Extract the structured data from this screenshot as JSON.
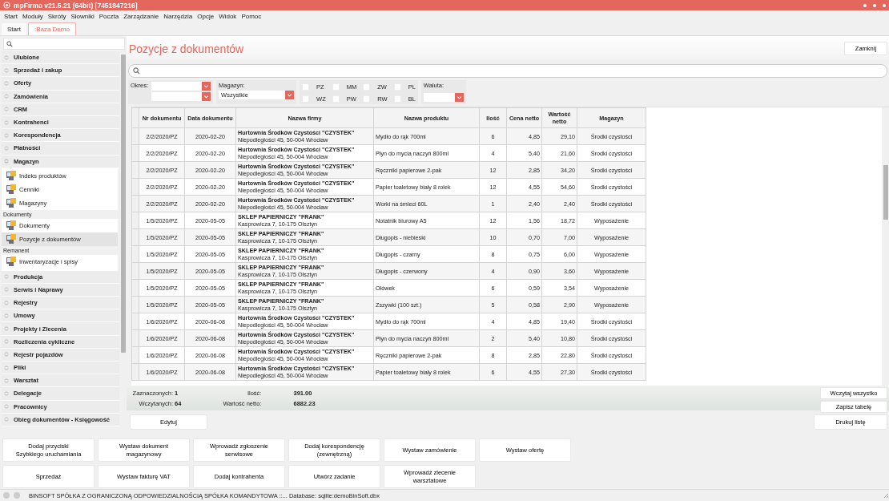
{
  "window": {
    "title": "mpFirma v21.5.21 (64bit) [7451847216]"
  },
  "menu": [
    "Start",
    "Moduły",
    "Skróty",
    "Słowniki",
    "Poczta",
    "Zarządzanie",
    "Narzędzia",
    "Opcje",
    "Widok",
    "Pomoc"
  ],
  "tabs": [
    {
      "label": "Start",
      "selected": false
    },
    {
      "label": ":Baza Demo",
      "selected": true
    }
  ],
  "sidebar": {
    "groups": [
      {
        "label": "Ulubione",
        "expanded": false
      },
      {
        "label": "Sprzedaż i zakup",
        "expanded": false
      },
      {
        "label": "Oferty",
        "expanded": false
      },
      {
        "label": "Zamówienia",
        "expanded": false
      },
      {
        "label": "CRM",
        "expanded": false
      },
      {
        "label": "Kontrahenci",
        "expanded": false
      },
      {
        "label": "Korespondencja",
        "expanded": false
      },
      {
        "label": "Płatności",
        "expanded": false
      },
      {
        "label": "Magazyn",
        "expanded": true,
        "children": [
          {
            "kind": "item",
            "label": "Indeks produktów",
            "selected": false
          },
          {
            "kind": "item",
            "label": "Cenniki",
            "selected": false
          },
          {
            "kind": "item",
            "label": "Magazyny",
            "selected": false
          },
          {
            "kind": "section",
            "label": "Dokumenty"
          },
          {
            "kind": "item",
            "label": "Dokumenty",
            "selected": false
          },
          {
            "kind": "item",
            "label": "Pozycje z dokumentów",
            "selected": true
          },
          {
            "kind": "section",
            "label": "Remanent"
          },
          {
            "kind": "item",
            "label": "Inwentaryzacje i spisy",
            "selected": false
          }
        ]
      },
      {
        "label": "Produkcja",
        "expanded": false
      },
      {
        "label": "Serwis i Naprawy",
        "expanded": false
      },
      {
        "label": "Rejestry",
        "expanded": false
      },
      {
        "label": "Umowy",
        "expanded": false
      },
      {
        "label": "Projekty i Zlecenia",
        "expanded": false
      },
      {
        "label": "Rozliczenia cykliczne",
        "expanded": false
      },
      {
        "label": "Rejestr pojazdów",
        "expanded": false
      },
      {
        "label": "Pliki",
        "expanded": false
      },
      {
        "label": "Warsztat",
        "expanded": false
      },
      {
        "label": "Delegacje",
        "expanded": false
      },
      {
        "label": "Pracownicy",
        "expanded": false
      },
      {
        "label": "Obieg dokumentów - Księgowość",
        "expanded": false
      }
    ]
  },
  "page": {
    "title": "Pozycje z dokumentów",
    "close_button": "Zamknij"
  },
  "filters": {
    "period_label": "Okres:",
    "warehouse_label": "Magazyn:",
    "warehouse_value": "Wszystkie",
    "currency_label": "Waluta:",
    "doc_types": [
      {
        "label": "PZ",
        "checked": false
      },
      {
        "label": "WZ",
        "checked": false
      },
      {
        "label": "MM",
        "checked": false
      },
      {
        "label": "PW",
        "checked": false
      },
      {
        "label": "ZW",
        "checked": false
      },
      {
        "label": "RW",
        "checked": false
      },
      {
        "label": "PL",
        "checked": false
      },
      {
        "label": "BL",
        "checked": false
      }
    ]
  },
  "table": {
    "columns": [
      "Nr dokumentu",
      "Data dokumentu",
      "Nazwa firmy",
      "Nazwa produktu",
      "Ilość",
      "Cena netto",
      "Wartość netto",
      "Magazyn"
    ],
    "rows": [
      {
        "nr": "2/2/2020/PZ",
        "date": "2020-02-20",
        "company": "Hurtownia Środków Czystości \"CZYSTEK\"",
        "address": "Niepodległości 45, 50-004 Wrocław",
        "product": "Mydło do rąk 700ml",
        "qty": "6",
        "price": "4,85",
        "value": "29,10",
        "warehouse": "Środki czystości"
      },
      {
        "nr": "2/2/2020/PZ",
        "date": "2020-02-20",
        "company": "Hurtownia Środków Czystości \"CZYSTEK\"",
        "address": "Niepodległości 45, 50-004 Wrocław",
        "product": "Płyn do mycia naczyń 800ml",
        "qty": "4",
        "price": "5,40",
        "value": "21,60",
        "warehouse": "Środki czystości"
      },
      {
        "nr": "2/2/2020/PZ",
        "date": "2020-02-20",
        "company": "Hurtownia Środków Czystości \"CZYSTEK\"",
        "address": "Niepodległości 45, 50-004 Wrocław",
        "product": "Ręczniki papierowe 2-pak",
        "qty": "12",
        "price": "2,85",
        "value": "34,20",
        "warehouse": "Środki czystości"
      },
      {
        "nr": "2/2/2020/PZ",
        "date": "2020-02-20",
        "company": "Hurtownia Środków Czystości \"CZYSTEK\"",
        "address": "Niepodległości 45, 50-004 Wrocław",
        "product": "Papier toaletowy biały 8 rolek",
        "qty": "12",
        "price": "4,55",
        "value": "54,60",
        "warehouse": "Środki czystości"
      },
      {
        "nr": "2/2/2020/PZ",
        "date": "2020-02-20",
        "company": "Hurtownia Środków Czystości \"CZYSTEK\"",
        "address": "Niepodległości 45, 50-004 Wrocław",
        "product": "Worki na śmieci 60L",
        "qty": "1",
        "price": "2,40",
        "value": "2,40",
        "warehouse": "Środki czystości"
      },
      {
        "nr": "1/5/2020/PZ",
        "date": "2020-05-05",
        "company": "SKLEP PAPIERNICZY \"FRANK\"",
        "address": "Kasprowicza 7, 10-175 Olsztyn",
        "product": "Notatnik biurowy A5",
        "qty": "12",
        "price": "1,56",
        "value": "18,72",
        "warehouse": "Wyposażenie"
      },
      {
        "nr": "1/5/2020/PZ",
        "date": "2020-05-05",
        "company": "SKLEP PAPIERNICZY \"FRANK\"",
        "address": "Kasprowicza 7, 10-175 Olsztyn",
        "product": "Długopis - niebieski",
        "qty": "10",
        "price": "0,70",
        "value": "7,00",
        "warehouse": "Wyposażenie"
      },
      {
        "nr": "1/5/2020/PZ",
        "date": "2020-05-05",
        "company": "SKLEP PAPIERNICZY \"FRANK\"",
        "address": "Kasprowicza 7, 10-175 Olsztyn",
        "product": "Długopis - czarny",
        "qty": "8",
        "price": "0,75",
        "value": "6,00",
        "warehouse": "Wyposażenie"
      },
      {
        "nr": "1/5/2020/PZ",
        "date": "2020-05-05",
        "company": "SKLEP PAPIERNICZY \"FRANK\"",
        "address": "Kasprowicza 7, 10-175 Olsztyn",
        "product": "Długopis - czerwony",
        "qty": "4",
        "price": "0,90",
        "value": "3,60",
        "warehouse": "Wyposażenie"
      },
      {
        "nr": "1/5/2020/PZ",
        "date": "2020-05-05",
        "company": "SKLEP PAPIERNICZY \"FRANK\"",
        "address": "Kasprowicza 7, 10-175 Olsztyn",
        "product": "Ołówek",
        "qty": "6",
        "price": "0,59",
        "value": "3,54",
        "warehouse": "Wyposażenie"
      },
      {
        "nr": "1/5/2020/PZ",
        "date": "2020-05-05",
        "company": "SKLEP PAPIERNICZY \"FRANK\"",
        "address": "Kasprowicza 7, 10-175 Olsztyn",
        "product": "Zszywki (100 szt.)",
        "qty": "5",
        "price": "0,58",
        "value": "2,90",
        "warehouse": "Wyposażenie"
      },
      {
        "nr": "1/6/2020/PZ",
        "date": "2020-06-08",
        "company": "Hurtownia Środków Czystości \"CZYSTEK\"",
        "address": "Niepodległości 45, 50-004 Wrocław",
        "product": "Mydło do rąk 700ml",
        "qty": "4",
        "price": "4,85",
        "value": "19,40",
        "warehouse": "Środki czystości"
      },
      {
        "nr": "1/6/2020/PZ",
        "date": "2020-06-08",
        "company": "Hurtownia Środków Czystości \"CZYSTEK\"",
        "address": "Niepodległości 45, 50-004 Wrocław",
        "product": "Płyn do mycia naczyń 800ml",
        "qty": "2",
        "price": "5,40",
        "value": "10,80",
        "warehouse": "Środki czystości"
      },
      {
        "nr": "1/6/2020/PZ",
        "date": "2020-06-08",
        "company": "Hurtownia Środków Czystości \"CZYSTEK\"",
        "address": "Niepodległości 45, 50-004 Wrocław",
        "product": "Ręczniki papierowe 2-pak",
        "qty": "8",
        "price": "2,85",
        "value": "22,80",
        "warehouse": "Środki czystości"
      },
      {
        "nr": "1/6/2020/PZ",
        "date": "2020-06-08",
        "company": "Hurtownia Środków Czystości \"CZYSTEK\"",
        "address": "Niepodległości 45, 50-004 Wrocław",
        "product": "Papier toaletowy biały 8 rolek",
        "qty": "6",
        "price": "4,55",
        "value": "27,30",
        "warehouse": "Środki czystości"
      }
    ]
  },
  "summary": {
    "selected_label": "Zaznaczonych:",
    "selected_value": "1",
    "loaded_label": "Wczytanych:",
    "loaded_value": "64",
    "qty_label": "Ilość:",
    "qty_value": "391.00",
    "net_label": "Wartość netto:",
    "net_value": "6882.23"
  },
  "side_buttons": [
    "Wczytaj wszystko",
    "Zapisz tabelę"
  ],
  "edit_button": "Edytuj",
  "print_button": "Drukuj listę",
  "quick_buttons": [
    [
      "Dodaj przyciski\nSzybkiego uruchamiania",
      "Wystaw dokument magazynowy",
      "Wprowadź zgłoszenie serwisowe",
      "Dodaj korespondencję (zewnętrzną)",
      "Wystaw zamówienie",
      "Wystaw ofertę"
    ],
    [
      "Sprzedaż",
      "Wystaw fakturę VAT",
      "Dodaj kontrahenta",
      "Utwórz zadanie",
      "Wprowadź zlecenie warsztatowe"
    ]
  ],
  "status_bar": {
    "text": "BINSOFT SPÓŁKA Z OGRANICZONĄ ODPOWIEDZIALNOŚCIĄ SPÓŁKA KOMANDYTOWA ::... Database: sqlite:demoBinSoft.dbx"
  }
}
